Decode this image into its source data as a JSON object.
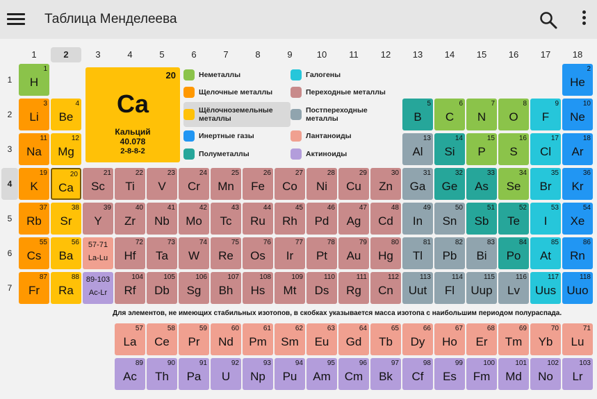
{
  "appbar": {
    "title": "Таблица Менделеева",
    "menu_icon": "hamburger-icon",
    "search_icon": "search-icon",
    "more_icon": "more-vert-icon"
  },
  "colors": {
    "nonmetal": "#8bc34a",
    "alkali": "#ff9800",
    "alkaline": "#ffc107",
    "noble": "#2196f3",
    "metalloid": "#26a69a",
    "halogen": "#26c6da",
    "transition": "#c88a8a",
    "post": "#90a4ae",
    "lanthanide": "#f0a090",
    "actinide": "#b39ddb",
    "selected_header": "#d9d9d9"
  },
  "groups": [
    "1",
    "2",
    "3",
    "4",
    "5",
    "6",
    "7",
    "8",
    "9",
    "10",
    "11",
    "12",
    "13",
    "14",
    "15",
    "16",
    "17",
    "18"
  ],
  "periods": [
    "1",
    "2",
    "3",
    "4",
    "5",
    "6",
    "7"
  ],
  "selected": {
    "group": "2",
    "period": "4"
  },
  "detail": {
    "number": "20",
    "symbol": "Ca",
    "name": "Кальций",
    "mass": "40.078",
    "shells": "2-8-8-2"
  },
  "legend": [
    {
      "label": "Неметаллы",
      "cat": "nonmetal"
    },
    {
      "label": "Щелочные металлы",
      "cat": "alkali"
    },
    {
      "label": "Щёлочноземельные металлы",
      "cat": "alkaline",
      "highlight": true
    },
    {
      "label": "Инертные газы",
      "cat": "noble"
    },
    {
      "label": "Полуметаллы",
      "cat": "metalloid"
    },
    {
      "label": "Галогены",
      "cat": "halogen"
    },
    {
      "label": "Переходные металлы",
      "cat": "transition"
    },
    {
      "label": "Постпереходные металлы",
      "cat": "post"
    },
    {
      "label": "Лантаноиды",
      "cat": "lanthanide"
    },
    {
      "label": "Актиноиды",
      "cat": "actinide"
    }
  ],
  "elements": [
    {
      "n": "1",
      "s": "H",
      "g": 1,
      "p": 1,
      "c": "nonmetal"
    },
    {
      "n": "2",
      "s": "He",
      "g": 18,
      "p": 1,
      "c": "noble"
    },
    {
      "n": "3",
      "s": "Li",
      "g": 1,
      "p": 2,
      "c": "alkali"
    },
    {
      "n": "4",
      "s": "Be",
      "g": 2,
      "p": 2,
      "c": "alkaline"
    },
    {
      "n": "5",
      "s": "B",
      "g": 13,
      "p": 2,
      "c": "metalloid"
    },
    {
      "n": "6",
      "s": "C",
      "g": 14,
      "p": 2,
      "c": "nonmetal"
    },
    {
      "n": "7",
      "s": "N",
      "g": 15,
      "p": 2,
      "c": "nonmetal"
    },
    {
      "n": "8",
      "s": "O",
      "g": 16,
      "p": 2,
      "c": "nonmetal"
    },
    {
      "n": "9",
      "s": "F",
      "g": 17,
      "p": 2,
      "c": "halogen"
    },
    {
      "n": "10",
      "s": "Ne",
      "g": 18,
      "p": 2,
      "c": "noble"
    },
    {
      "n": "11",
      "s": "Na",
      "g": 1,
      "p": 3,
      "c": "alkali"
    },
    {
      "n": "12",
      "s": "Mg",
      "g": 2,
      "p": 3,
      "c": "alkaline"
    },
    {
      "n": "13",
      "s": "Al",
      "g": 13,
      "p": 3,
      "c": "post"
    },
    {
      "n": "14",
      "s": "Si",
      "g": 14,
      "p": 3,
      "c": "metalloid"
    },
    {
      "n": "15",
      "s": "P",
      "g": 15,
      "p": 3,
      "c": "nonmetal"
    },
    {
      "n": "16",
      "s": "S",
      "g": 16,
      "p": 3,
      "c": "nonmetal"
    },
    {
      "n": "17",
      "s": "Cl",
      "g": 17,
      "p": 3,
      "c": "halogen"
    },
    {
      "n": "18",
      "s": "Ar",
      "g": 18,
      "p": 3,
      "c": "noble"
    },
    {
      "n": "19",
      "s": "K",
      "g": 1,
      "p": 4,
      "c": "alkali"
    },
    {
      "n": "20",
      "s": "Ca",
      "g": 2,
      "p": 4,
      "c": "alkaline",
      "selected": true
    },
    {
      "n": "21",
      "s": "Sc",
      "g": 3,
      "p": 4,
      "c": "transition"
    },
    {
      "n": "22",
      "s": "Ti",
      "g": 4,
      "p": 4,
      "c": "transition"
    },
    {
      "n": "23",
      "s": "V",
      "g": 5,
      "p": 4,
      "c": "transition"
    },
    {
      "n": "24",
      "s": "Cr",
      "g": 6,
      "p": 4,
      "c": "transition"
    },
    {
      "n": "25",
      "s": "Mn",
      "g": 7,
      "p": 4,
      "c": "transition"
    },
    {
      "n": "26",
      "s": "Fe",
      "g": 8,
      "p": 4,
      "c": "transition"
    },
    {
      "n": "27",
      "s": "Co",
      "g": 9,
      "p": 4,
      "c": "transition"
    },
    {
      "n": "28",
      "s": "Ni",
      "g": 10,
      "p": 4,
      "c": "transition"
    },
    {
      "n": "29",
      "s": "Cu",
      "g": 11,
      "p": 4,
      "c": "transition"
    },
    {
      "n": "30",
      "s": "Zn",
      "g": 12,
      "p": 4,
      "c": "transition"
    },
    {
      "n": "31",
      "s": "Ga",
      "g": 13,
      "p": 4,
      "c": "post"
    },
    {
      "n": "32",
      "s": "Ge",
      "g": 14,
      "p": 4,
      "c": "metalloid"
    },
    {
      "n": "33",
      "s": "As",
      "g": 15,
      "p": 4,
      "c": "metalloid"
    },
    {
      "n": "34",
      "s": "Se",
      "g": 16,
      "p": 4,
      "c": "nonmetal"
    },
    {
      "n": "35",
      "s": "Br",
      "g": 17,
      "p": 4,
      "c": "halogen"
    },
    {
      "n": "36",
      "s": "Kr",
      "g": 18,
      "p": 4,
      "c": "noble"
    },
    {
      "n": "37",
      "s": "Rb",
      "g": 1,
      "p": 5,
      "c": "alkali"
    },
    {
      "n": "38",
      "s": "Sr",
      "g": 2,
      "p": 5,
      "c": "alkaline"
    },
    {
      "n": "39",
      "s": "Y",
      "g": 3,
      "p": 5,
      "c": "transition"
    },
    {
      "n": "40",
      "s": "Zr",
      "g": 4,
      "p": 5,
      "c": "transition"
    },
    {
      "n": "41",
      "s": "Nb",
      "g": 5,
      "p": 5,
      "c": "transition"
    },
    {
      "n": "42",
      "s": "Mo",
      "g": 6,
      "p": 5,
      "c": "transition"
    },
    {
      "n": "43",
      "s": "Tc",
      "g": 7,
      "p": 5,
      "c": "transition"
    },
    {
      "n": "44",
      "s": "Ru",
      "g": 8,
      "p": 5,
      "c": "transition"
    },
    {
      "n": "45",
      "s": "Rh",
      "g": 9,
      "p": 5,
      "c": "transition"
    },
    {
      "n": "46",
      "s": "Pd",
      "g": 10,
      "p": 5,
      "c": "transition"
    },
    {
      "n": "47",
      "s": "Ag",
      "g": 11,
      "p": 5,
      "c": "transition"
    },
    {
      "n": "48",
      "s": "Cd",
      "g": 12,
      "p": 5,
      "c": "transition"
    },
    {
      "n": "49",
      "s": "In",
      "g": 13,
      "p": 5,
      "c": "post"
    },
    {
      "n": "50",
      "s": "Sn",
      "g": 14,
      "p": 5,
      "c": "post"
    },
    {
      "n": "51",
      "s": "Sb",
      "g": 15,
      "p": 5,
      "c": "metalloid"
    },
    {
      "n": "52",
      "s": "Te",
      "g": 16,
      "p": 5,
      "c": "metalloid"
    },
    {
      "n": "53",
      "s": "I",
      "g": 17,
      "p": 5,
      "c": "halogen"
    },
    {
      "n": "54",
      "s": "Xe",
      "g": 18,
      "p": 5,
      "c": "noble"
    },
    {
      "n": "55",
      "s": "Cs",
      "g": 1,
      "p": 6,
      "c": "alkali"
    },
    {
      "n": "56",
      "s": "Ba",
      "g": 2,
      "p": 6,
      "c": "alkaline"
    },
    {
      "n": "72",
      "s": "Hf",
      "g": 4,
      "p": 6,
      "c": "transition"
    },
    {
      "n": "73",
      "s": "Ta",
      "g": 5,
      "p": 6,
      "c": "transition"
    },
    {
      "n": "74",
      "s": "W",
      "g": 6,
      "p": 6,
      "c": "transition"
    },
    {
      "n": "75",
      "s": "Re",
      "g": 7,
      "p": 6,
      "c": "transition"
    },
    {
      "n": "76",
      "s": "Os",
      "g": 8,
      "p": 6,
      "c": "transition"
    },
    {
      "n": "77",
      "s": "Ir",
      "g": 9,
      "p": 6,
      "c": "transition"
    },
    {
      "n": "78",
      "s": "Pt",
      "g": 10,
      "p": 6,
      "c": "transition"
    },
    {
      "n": "79",
      "s": "Au",
      "g": 11,
      "p": 6,
      "c": "transition"
    },
    {
      "n": "80",
      "s": "Hg",
      "g": 12,
      "p": 6,
      "c": "transition"
    },
    {
      "n": "81",
      "s": "Tl",
      "g": 13,
      "p": 6,
      "c": "post"
    },
    {
      "n": "82",
      "s": "Pb",
      "g": 14,
      "p": 6,
      "c": "post"
    },
    {
      "n": "83",
      "s": "Bi",
      "g": 15,
      "p": 6,
      "c": "post"
    },
    {
      "n": "84",
      "s": "Po",
      "g": 16,
      "p": 6,
      "c": "metalloid"
    },
    {
      "n": "85",
      "s": "At",
      "g": 17,
      "p": 6,
      "c": "halogen"
    },
    {
      "n": "86",
      "s": "Rn",
      "g": 18,
      "p": 6,
      "c": "noble"
    },
    {
      "n": "87",
      "s": "Fr",
      "g": 1,
      "p": 7,
      "c": "alkali"
    },
    {
      "n": "88",
      "s": "Ra",
      "g": 2,
      "p": 7,
      "c": "alkaline"
    },
    {
      "n": "104",
      "s": "Rf",
      "g": 4,
      "p": 7,
      "c": "transition"
    },
    {
      "n": "105",
      "s": "Db",
      "g": 5,
      "p": 7,
      "c": "transition"
    },
    {
      "n": "106",
      "s": "Sg",
      "g": 6,
      "p": 7,
      "c": "transition"
    },
    {
      "n": "107",
      "s": "Bh",
      "g": 7,
      "p": 7,
      "c": "transition"
    },
    {
      "n": "108",
      "s": "Hs",
      "g": 8,
      "p": 7,
      "c": "transition"
    },
    {
      "n": "109",
      "s": "Mt",
      "g": 9,
      "p": 7,
      "c": "transition"
    },
    {
      "n": "110",
      "s": "Ds",
      "g": 10,
      "p": 7,
      "c": "transition"
    },
    {
      "n": "111",
      "s": "Rg",
      "g": 11,
      "p": 7,
      "c": "transition"
    },
    {
      "n": "112",
      "s": "Cn",
      "g": 12,
      "p": 7,
      "c": "transition"
    },
    {
      "n": "113",
      "s": "Uut",
      "g": 13,
      "p": 7,
      "c": "post"
    },
    {
      "n": "114",
      "s": "Fl",
      "g": 14,
      "p": 7,
      "c": "post"
    },
    {
      "n": "115",
      "s": "Uup",
      "g": 15,
      "p": 7,
      "c": "post"
    },
    {
      "n": "116",
      "s": "Lv",
      "g": 16,
      "p": 7,
      "c": "post"
    },
    {
      "n": "117",
      "s": "Uus",
      "g": 17,
      "p": 7,
      "c": "halogen"
    },
    {
      "n": "118",
      "s": "Uuo",
      "g": 18,
      "p": 7,
      "c": "noble"
    }
  ],
  "ranges": [
    {
      "label": "57-71",
      "sym": "La-Lu",
      "g": 3,
      "p": 6,
      "c": "lanthanide"
    },
    {
      "label": "89-103",
      "sym": "Ac-Lr",
      "g": 3,
      "p": 7,
      "c": "actinide"
    }
  ],
  "note": "Для элементов, не имеющих стабильных изотопов, в скобках указывается масса изотопа с наибольшим периодом полураспада.",
  "lanthanides": [
    {
      "n": "57",
      "s": "La"
    },
    {
      "n": "58",
      "s": "Ce"
    },
    {
      "n": "59",
      "s": "Pr"
    },
    {
      "n": "60",
      "s": "Nd"
    },
    {
      "n": "61",
      "s": "Pm"
    },
    {
      "n": "62",
      "s": "Sm"
    },
    {
      "n": "63",
      "s": "Eu"
    },
    {
      "n": "64",
      "s": "Gd"
    },
    {
      "n": "65",
      "s": "Tb"
    },
    {
      "n": "66",
      "s": "Dy"
    },
    {
      "n": "67",
      "s": "Ho"
    },
    {
      "n": "68",
      "s": "Er"
    },
    {
      "n": "69",
      "s": "Tm"
    },
    {
      "n": "70",
      "s": "Yb"
    },
    {
      "n": "71",
      "s": "Lu"
    }
  ],
  "actinides": [
    {
      "n": "89",
      "s": "Ac"
    },
    {
      "n": "90",
      "s": "Th"
    },
    {
      "n": "91",
      "s": "Pa"
    },
    {
      "n": "92",
      "s": "U"
    },
    {
      "n": "93",
      "s": "Np"
    },
    {
      "n": "94",
      "s": "Pu"
    },
    {
      "n": "95",
      "s": "Am"
    },
    {
      "n": "96",
      "s": "Cm"
    },
    {
      "n": "97",
      "s": "Bk"
    },
    {
      "n": "98",
      "s": "Cf"
    },
    {
      "n": "99",
      "s": "Es"
    },
    {
      "n": "100",
      "s": "Fm"
    },
    {
      "n": "101",
      "s": "Md"
    },
    {
      "n": "102",
      "s": "No"
    },
    {
      "n": "103",
      "s": "Lr"
    }
  ]
}
